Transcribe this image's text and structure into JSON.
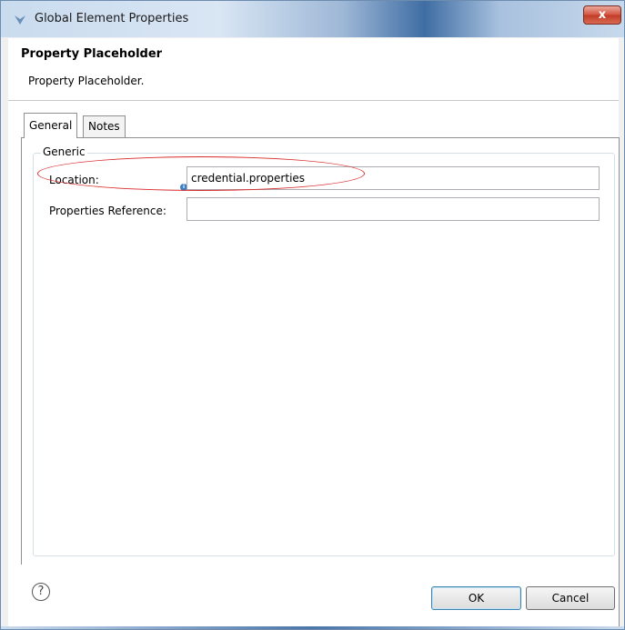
{
  "window": {
    "title": "Global Element Properties",
    "close_symbol": "x"
  },
  "header": {
    "title": "Property Placeholder",
    "description": "Property Placeholder."
  },
  "tabs": [
    {
      "label": "General",
      "active": true
    },
    {
      "label": "Notes",
      "active": false
    }
  ],
  "group": {
    "legend": "Generic",
    "fields": [
      {
        "label": "Location:",
        "value": "credential.properties"
      },
      {
        "label": "Properties Reference:",
        "value": ""
      }
    ]
  },
  "footer": {
    "help_symbol": "?",
    "ok_label": "OK",
    "cancel_label": "Cancel"
  },
  "colors": {
    "highlight": "#d82a2a",
    "info_icon": "#3c7fc4"
  },
  "icons": {
    "app": "app-icon",
    "close": "close-icon",
    "info": "info-icon",
    "help": "help-icon"
  }
}
